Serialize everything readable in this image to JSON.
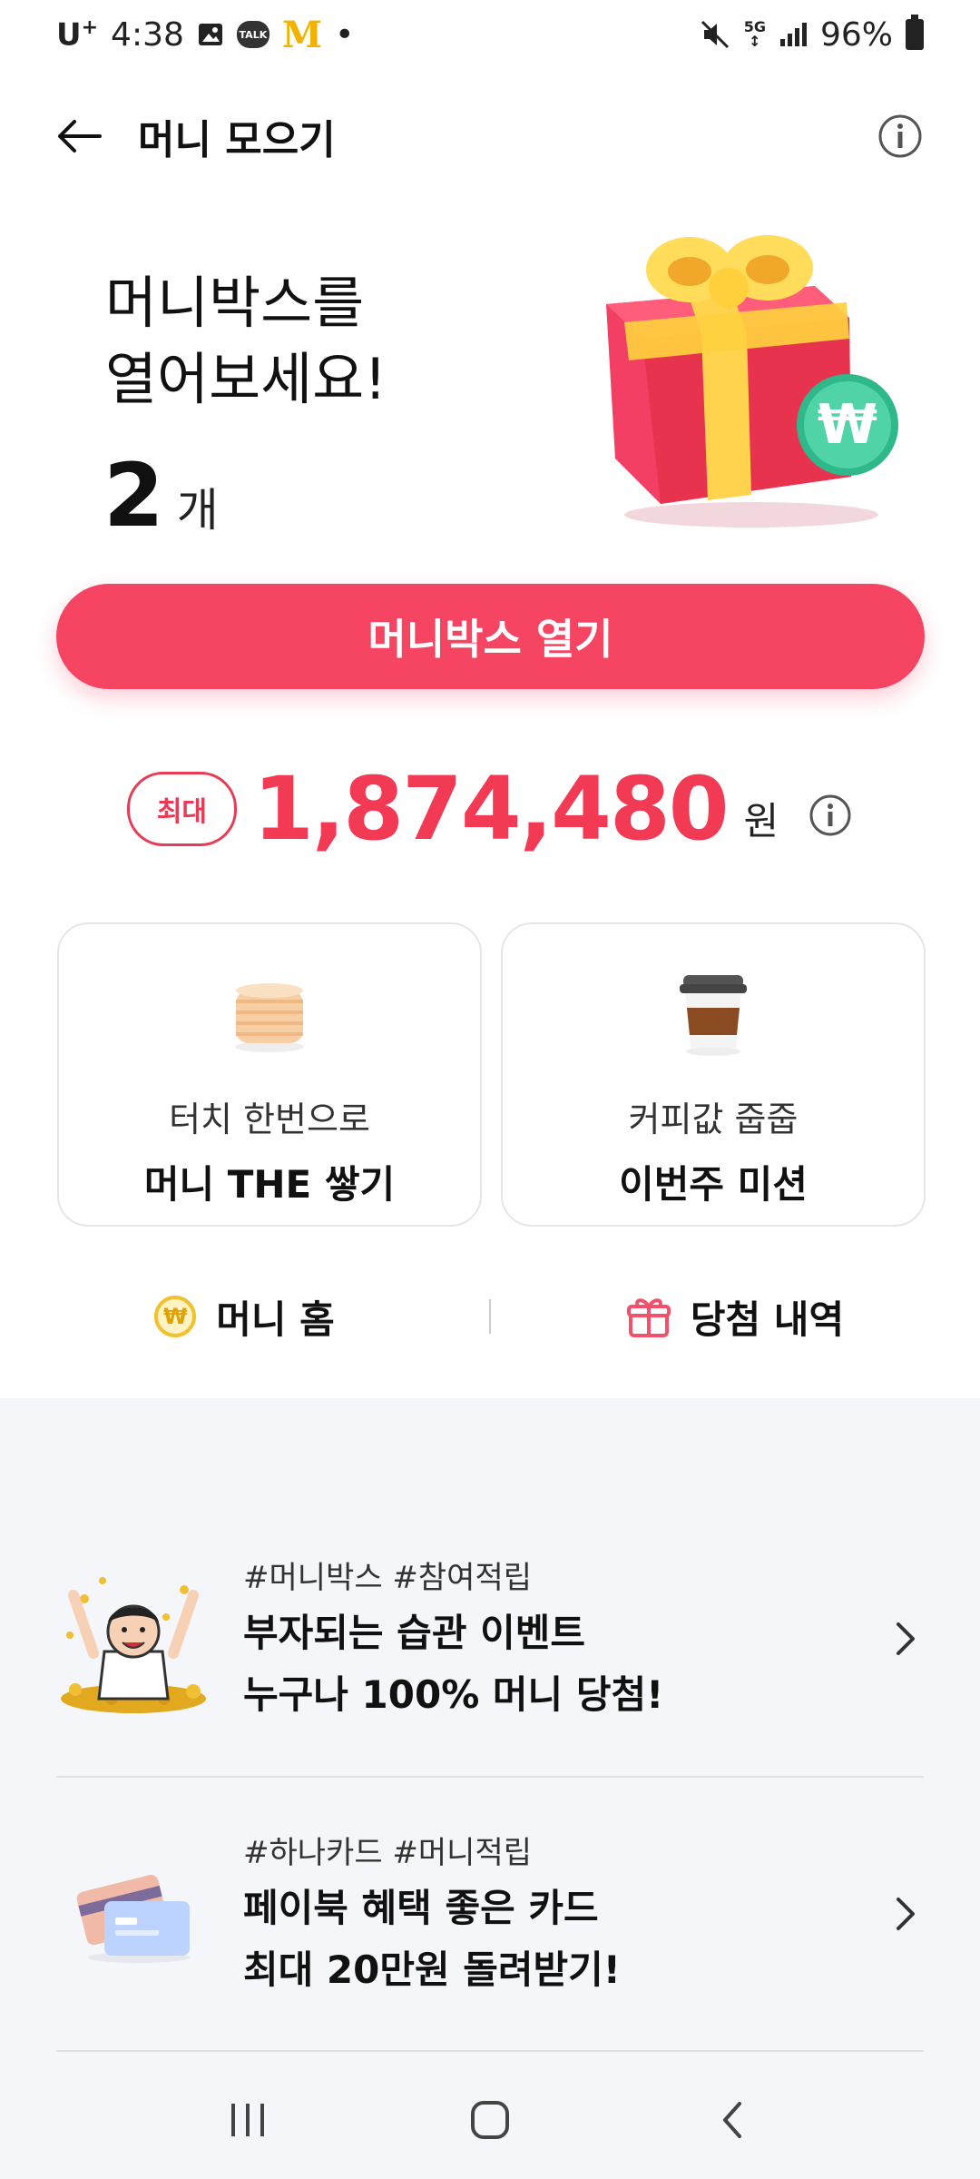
{
  "status_bar": {
    "carrier": "U",
    "carrier_sup": "+",
    "time": "4:38",
    "talk": "TALK",
    "mcd": "M",
    "dot": "•",
    "network": "5G",
    "battery": "96%"
  },
  "app_bar": {
    "title": "머니 모으기"
  },
  "hero": {
    "title_line1": "머니박스를",
    "title_line2": "열어보세요!",
    "count": "2",
    "count_unit": "개",
    "gift_coin_symbol": "₩"
  },
  "open_button": "머니박스 열기",
  "max": {
    "badge": "최대",
    "amount": "1,874,480",
    "unit": "원"
  },
  "cards": [
    {
      "sub": "터치 한번으로",
      "main": "머니 THE 쌓기",
      "icon": "coin-stack-icon"
    },
    {
      "sub": "커피값 줍줍",
      "main": "이번주 미션",
      "icon": "coffee-cup-icon"
    }
  ],
  "links": {
    "money_home": "머니 홈",
    "money_home_symbol": "₩",
    "winnings": "당첨 내역"
  },
  "events": [
    {
      "tags": "#머니박스 #참여적립",
      "title_line1": "부자되는 습관 이벤트",
      "title_line2": "누구나 100% 머니 당첨!"
    },
    {
      "tags": "#하나카드 #머니적립",
      "title_line1": "페이북 혜택 좋은 카드",
      "title_line2": "최대 20만원 돌려받기!"
    }
  ],
  "colors": {
    "accent": "#f64463",
    "amount": "#f23a55",
    "background_grey": "#f5f6fa"
  }
}
